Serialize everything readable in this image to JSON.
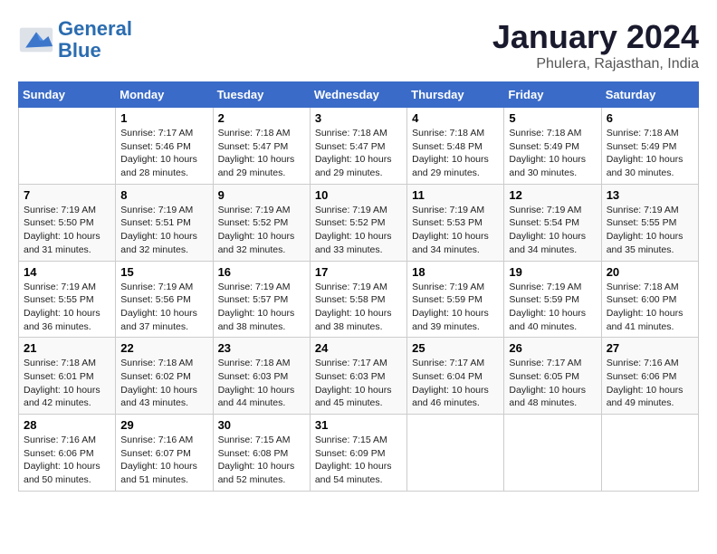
{
  "header": {
    "logo_line1": "General",
    "logo_line2": "Blue",
    "month_year": "January 2024",
    "location": "Phulera, Rajasthan, India"
  },
  "days_of_week": [
    "Sunday",
    "Monday",
    "Tuesday",
    "Wednesday",
    "Thursday",
    "Friday",
    "Saturday"
  ],
  "weeks": [
    [
      {
        "day": "",
        "info": ""
      },
      {
        "day": "1",
        "info": "Sunrise: 7:17 AM\nSunset: 5:46 PM\nDaylight: 10 hours\nand 28 minutes."
      },
      {
        "day": "2",
        "info": "Sunrise: 7:18 AM\nSunset: 5:47 PM\nDaylight: 10 hours\nand 29 minutes."
      },
      {
        "day": "3",
        "info": "Sunrise: 7:18 AM\nSunset: 5:47 PM\nDaylight: 10 hours\nand 29 minutes."
      },
      {
        "day": "4",
        "info": "Sunrise: 7:18 AM\nSunset: 5:48 PM\nDaylight: 10 hours\nand 29 minutes."
      },
      {
        "day": "5",
        "info": "Sunrise: 7:18 AM\nSunset: 5:49 PM\nDaylight: 10 hours\nand 30 minutes."
      },
      {
        "day": "6",
        "info": "Sunrise: 7:18 AM\nSunset: 5:49 PM\nDaylight: 10 hours\nand 30 minutes."
      }
    ],
    [
      {
        "day": "7",
        "info": "Sunrise: 7:19 AM\nSunset: 5:50 PM\nDaylight: 10 hours\nand 31 minutes."
      },
      {
        "day": "8",
        "info": "Sunrise: 7:19 AM\nSunset: 5:51 PM\nDaylight: 10 hours\nand 32 minutes."
      },
      {
        "day": "9",
        "info": "Sunrise: 7:19 AM\nSunset: 5:52 PM\nDaylight: 10 hours\nand 32 minutes."
      },
      {
        "day": "10",
        "info": "Sunrise: 7:19 AM\nSunset: 5:52 PM\nDaylight: 10 hours\nand 33 minutes."
      },
      {
        "day": "11",
        "info": "Sunrise: 7:19 AM\nSunset: 5:53 PM\nDaylight: 10 hours\nand 34 minutes."
      },
      {
        "day": "12",
        "info": "Sunrise: 7:19 AM\nSunset: 5:54 PM\nDaylight: 10 hours\nand 34 minutes."
      },
      {
        "day": "13",
        "info": "Sunrise: 7:19 AM\nSunset: 5:55 PM\nDaylight: 10 hours\nand 35 minutes."
      }
    ],
    [
      {
        "day": "14",
        "info": "Sunrise: 7:19 AM\nSunset: 5:55 PM\nDaylight: 10 hours\nand 36 minutes."
      },
      {
        "day": "15",
        "info": "Sunrise: 7:19 AM\nSunset: 5:56 PM\nDaylight: 10 hours\nand 37 minutes."
      },
      {
        "day": "16",
        "info": "Sunrise: 7:19 AM\nSunset: 5:57 PM\nDaylight: 10 hours\nand 38 minutes."
      },
      {
        "day": "17",
        "info": "Sunrise: 7:19 AM\nSunset: 5:58 PM\nDaylight: 10 hours\nand 38 minutes."
      },
      {
        "day": "18",
        "info": "Sunrise: 7:19 AM\nSunset: 5:59 PM\nDaylight: 10 hours\nand 39 minutes."
      },
      {
        "day": "19",
        "info": "Sunrise: 7:19 AM\nSunset: 5:59 PM\nDaylight: 10 hours\nand 40 minutes."
      },
      {
        "day": "20",
        "info": "Sunrise: 7:18 AM\nSunset: 6:00 PM\nDaylight: 10 hours\nand 41 minutes."
      }
    ],
    [
      {
        "day": "21",
        "info": "Sunrise: 7:18 AM\nSunset: 6:01 PM\nDaylight: 10 hours\nand 42 minutes."
      },
      {
        "day": "22",
        "info": "Sunrise: 7:18 AM\nSunset: 6:02 PM\nDaylight: 10 hours\nand 43 minutes."
      },
      {
        "day": "23",
        "info": "Sunrise: 7:18 AM\nSunset: 6:03 PM\nDaylight: 10 hours\nand 44 minutes."
      },
      {
        "day": "24",
        "info": "Sunrise: 7:17 AM\nSunset: 6:03 PM\nDaylight: 10 hours\nand 45 minutes."
      },
      {
        "day": "25",
        "info": "Sunrise: 7:17 AM\nSunset: 6:04 PM\nDaylight: 10 hours\nand 46 minutes."
      },
      {
        "day": "26",
        "info": "Sunrise: 7:17 AM\nSunset: 6:05 PM\nDaylight: 10 hours\nand 48 minutes."
      },
      {
        "day": "27",
        "info": "Sunrise: 7:16 AM\nSunset: 6:06 PM\nDaylight: 10 hours\nand 49 minutes."
      }
    ],
    [
      {
        "day": "28",
        "info": "Sunrise: 7:16 AM\nSunset: 6:06 PM\nDaylight: 10 hours\nand 50 minutes."
      },
      {
        "day": "29",
        "info": "Sunrise: 7:16 AM\nSunset: 6:07 PM\nDaylight: 10 hours\nand 51 minutes."
      },
      {
        "day": "30",
        "info": "Sunrise: 7:15 AM\nSunset: 6:08 PM\nDaylight: 10 hours\nand 52 minutes."
      },
      {
        "day": "31",
        "info": "Sunrise: 7:15 AM\nSunset: 6:09 PM\nDaylight: 10 hours\nand 54 minutes."
      },
      {
        "day": "",
        "info": ""
      },
      {
        "day": "",
        "info": ""
      },
      {
        "day": "",
        "info": ""
      }
    ]
  ]
}
